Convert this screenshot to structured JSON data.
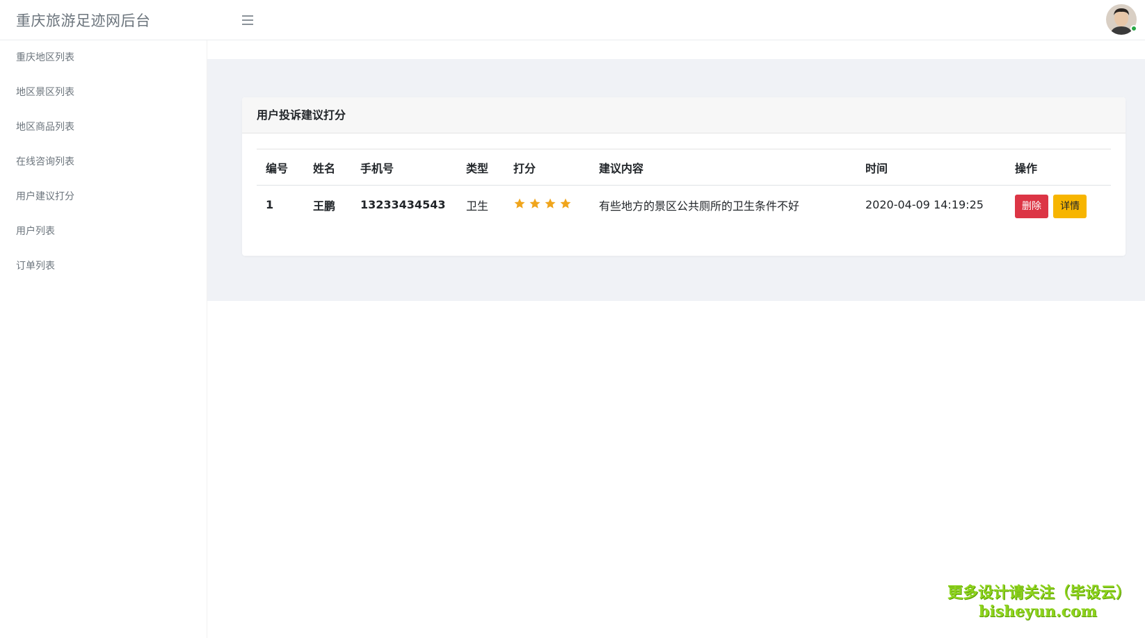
{
  "header": {
    "brand": "重庆旅游足迹网后台",
    "menu_icon": "hamburger-icon",
    "avatar_icon": "user-avatar"
  },
  "sidebar": {
    "items": [
      {
        "label": "重庆地区列表"
      },
      {
        "label": "地区景区列表"
      },
      {
        "label": "地区商品列表"
      },
      {
        "label": "在线咨询列表"
      },
      {
        "label": "用户建议打分"
      },
      {
        "label": "用户列表"
      },
      {
        "label": "订单列表"
      }
    ]
  },
  "card": {
    "title": "用户投诉建议打分",
    "columns": [
      "编号",
      "姓名",
      "手机号",
      "类型",
      "打分",
      "建议内容",
      "时间",
      "操作"
    ],
    "rows": [
      {
        "id": "1",
        "name": "王鹏",
        "phone": "13233434543",
        "type": "卫生",
        "rating": 4,
        "content": "有些地方的景区公共厕所的卫生条件不好",
        "time": "2020-04-09 14:19:25",
        "delete_label": "删除",
        "detail_label": "详情"
      }
    ]
  },
  "watermark": {
    "line1": "更多设计请关注（毕设云）",
    "line2": "bisheyun.com"
  },
  "colors": {
    "danger": "#dc3545",
    "warning": "#f7b500",
    "star": "#f0a51c",
    "content_bg": "#f0f2f6"
  }
}
